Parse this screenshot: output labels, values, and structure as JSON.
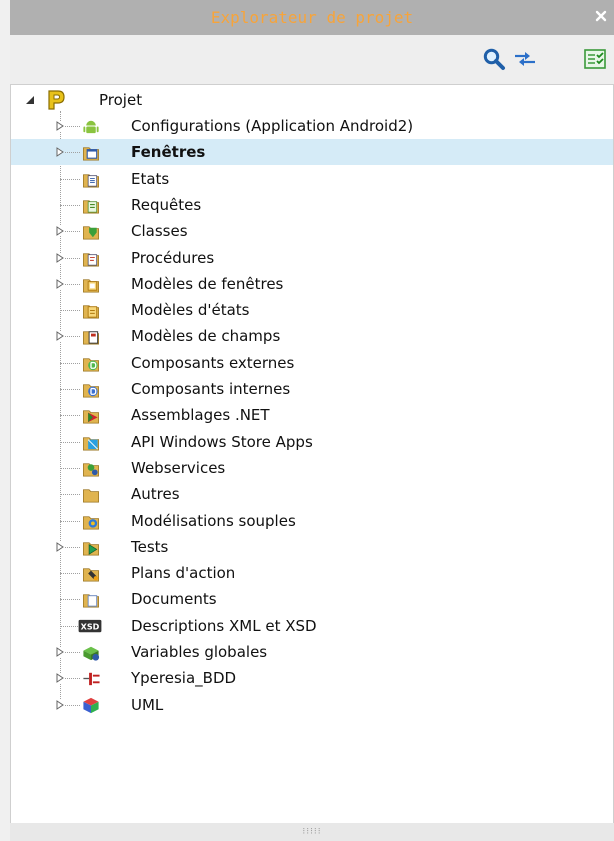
{
  "title": "Explorateur de projet",
  "toolbar": {
    "search_icon": "magnifier-icon",
    "sync_icon": "sync-arrows-icon",
    "checklist_icon": "checklist-icon"
  },
  "grip": "⁝⁝⁝⁝⁝",
  "root": {
    "label": "Projet",
    "icon": "project-p-icon"
  },
  "items": [
    {
      "label": "Configurations (Application Android2)",
      "icon": "android-icon",
      "expandable": true,
      "selected": false,
      "bold": false
    },
    {
      "label": "Fenêtres",
      "icon": "windows-folder-icon",
      "expandable": true,
      "selected": true,
      "bold": true
    },
    {
      "label": "Etats",
      "icon": "reports-folder-icon",
      "expandable": false,
      "selected": false,
      "bold": false
    },
    {
      "label": "Requêtes",
      "icon": "queries-folder-icon",
      "expandable": false,
      "selected": false,
      "bold": false
    },
    {
      "label": "Classes",
      "icon": "classes-folder-icon",
      "expandable": true,
      "selected": false,
      "bold": false
    },
    {
      "label": "Procédures",
      "icon": "procedures-folder-icon",
      "expandable": true,
      "selected": false,
      "bold": false
    },
    {
      "label": "Modèles de fenêtres",
      "icon": "window-templates-folder-icon",
      "expandable": true,
      "selected": false,
      "bold": false
    },
    {
      "label": "Modèles d'états",
      "icon": "report-templates-folder-icon",
      "expandable": false,
      "selected": false,
      "bold": false
    },
    {
      "label": "Modèles de champs",
      "icon": "control-templates-folder-icon",
      "expandable": true,
      "selected": false,
      "bold": false
    },
    {
      "label": "Composants externes",
      "icon": "external-components-folder-icon",
      "expandable": false,
      "selected": false,
      "bold": false
    },
    {
      "label": "Composants internes",
      "icon": "internal-components-folder-icon",
      "expandable": false,
      "selected": false,
      "bold": false
    },
    {
      "label": "Assemblages .NET",
      "icon": "dotnet-assemblies-folder-icon",
      "expandable": false,
      "selected": false,
      "bold": false
    },
    {
      "label": "API Windows Store Apps",
      "icon": "windows-store-api-folder-icon",
      "expandable": false,
      "selected": false,
      "bold": false
    },
    {
      "label": "Webservices",
      "icon": "webservices-folder-icon",
      "expandable": false,
      "selected": false,
      "bold": false
    },
    {
      "label": "Autres",
      "icon": "others-folder-icon",
      "expandable": false,
      "selected": false,
      "bold": false
    },
    {
      "label": "Modélisations souples",
      "icon": "flexible-modeling-folder-icon",
      "expandable": false,
      "selected": false,
      "bold": false
    },
    {
      "label": "Tests",
      "icon": "tests-folder-icon",
      "expandable": true,
      "selected": false,
      "bold": false
    },
    {
      "label": "Plans d'action",
      "icon": "action-plans-folder-icon",
      "expandable": false,
      "selected": false,
      "bold": false
    },
    {
      "label": "Documents",
      "icon": "documents-folder-icon",
      "expandable": false,
      "selected": false,
      "bold": false
    },
    {
      "label": "Descriptions XML et XSD",
      "icon": "xsd-badge-icon",
      "badge": "XSD",
      "expandable": false,
      "selected": false,
      "bold": false
    },
    {
      "label": "Variables globales",
      "icon": "global-variables-icon",
      "expandable": true,
      "selected": false,
      "bold": false
    },
    {
      "label": "Yperesia_BDD",
      "icon": "database-connection-icon",
      "expandable": true,
      "selected": false,
      "bold": false
    },
    {
      "label": "UML",
      "icon": "uml-cube-icon",
      "expandable": true,
      "selected": false,
      "bold": false
    }
  ],
  "colors": {
    "title_text": "#f7a43a",
    "title_bar": "#b0b0b0",
    "selection": "#d5ebf7",
    "folder": "#e0b450"
  }
}
